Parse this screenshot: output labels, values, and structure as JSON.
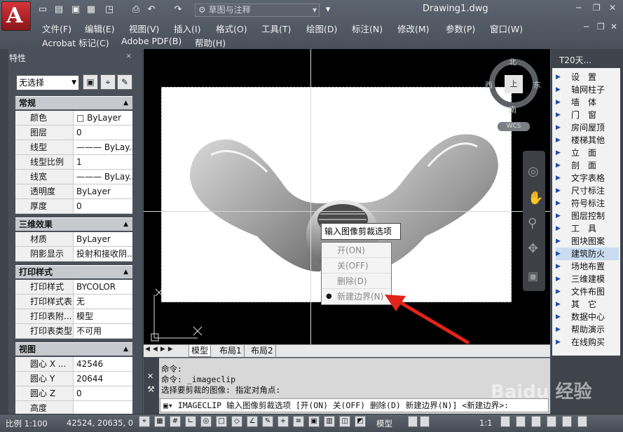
{
  "window": {
    "title": "Drawing1.dwg",
    "workspace": "草图与注释"
  },
  "menubar": [
    "文件(F)",
    "编辑(E)",
    "视图(V)",
    "插入(I)",
    "格式(O)",
    "工具(T)",
    "绘图(D)",
    "标注(N)",
    "修改(M)",
    "参数(P)",
    "窗口(W)"
  ],
  "menubar2": [
    "Acrobat 标记(C)",
    "Adobe PDF(B)",
    "帮助(H)"
  ],
  "properties": {
    "title": "特性",
    "selection": "无选择",
    "sections": [
      {
        "name": "常规",
        "rows": [
          [
            "颜色",
            "□ ByLayer"
          ],
          [
            "图层",
            "0"
          ],
          [
            "线型",
            "——— ByLay..."
          ],
          [
            "线型比例",
            "1"
          ],
          [
            "线宽",
            "——— ByLay..."
          ],
          [
            "透明度",
            "ByLayer"
          ],
          [
            "厚度",
            "0"
          ]
        ]
      },
      {
        "name": "三维效果",
        "rows": [
          [
            "材质",
            "ByLayer"
          ],
          [
            "阴影显示",
            "投射和接收阴..."
          ]
        ]
      },
      {
        "name": "打印样式",
        "rows": [
          [
            "打印样式",
            "BYCOLOR"
          ],
          [
            "打印样式表",
            "无"
          ],
          [
            "打印表附...",
            "模型"
          ],
          [
            "打印表类型",
            "不可用"
          ]
        ]
      },
      {
        "name": "视图",
        "rows": [
          [
            "圆心 X ...",
            "42546"
          ],
          [
            "圆心 Y 坐...",
            "20644"
          ],
          [
            "圆心 Z 坐...",
            "0"
          ],
          [
            "高度",
            ""
          ]
        ]
      }
    ]
  },
  "viewcube": {
    "north": "北",
    "south": "南",
    "east": "东",
    "west": "西",
    "top": "上",
    "wcs": "WCS"
  },
  "context_menu": {
    "header": "输入图像剪裁选项",
    "items": [
      {
        "label": "开(ON)",
        "checked": false
      },
      {
        "label": "关(OFF)",
        "checked": false
      },
      {
        "label": "删除(D)",
        "checked": false
      },
      {
        "label": "新建边界(N)",
        "checked": true
      }
    ]
  },
  "layout_tabs": [
    "模型",
    "布局1",
    "布局2"
  ],
  "command": {
    "history": [
      "命令:",
      "命令: _imageclip",
      "选择要剪裁的图像: 指定对角点:"
    ],
    "prompt": "IMAGECLIP 输入图像剪裁选项 [开(ON) 关(OFF) 删除(D) 新建边界(N)] <新建边界>:"
  },
  "tool_palette": {
    "title": "T20天...",
    "items": [
      "设　置",
      "轴网柱子",
      "墙　体",
      "门　窗",
      "房间屋顶",
      "楼梯其他",
      "立　面",
      "剖　面",
      "文字表格",
      "尺寸标注",
      "符号标注",
      "图层控制",
      "工　具",
      "图块图案",
      "建筑防火",
      "场地布置",
      "三维建模",
      "文件布图",
      "其　它",
      "数据中心",
      "帮助演示",
      "在线购买"
    ]
  },
  "status": {
    "scale": "比例 1:100",
    "coords": "42524, 20635, 0",
    "model": "模型",
    "zoom": "1:1"
  },
  "watermark": "Baidu 经验",
  "accent": "#c8212a"
}
